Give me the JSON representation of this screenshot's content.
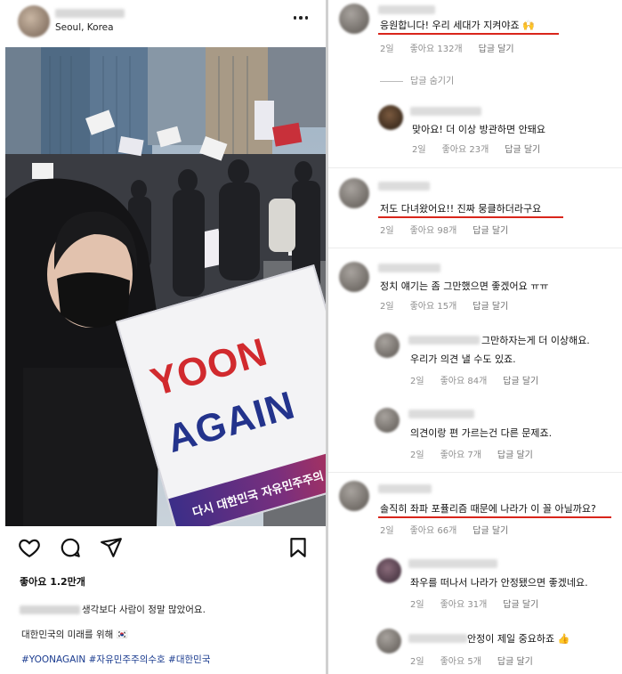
{
  "post": {
    "location": "Seoul, Korea",
    "likes": "좋아요 1.2만개",
    "caption_line1": "생각보다 사람이 정말 많았어요.",
    "caption_line2": "대한민국의 미래를 위해 🇰🇷",
    "hashtags": "#YOONAGAIN #자유민주주의수호 #대한민국",
    "sign": {
      "line1": "YOON",
      "line2": "AGAIN",
      "band": "다시 대한민국 자유민주주의 수호"
    },
    "icons": [
      "heart-icon",
      "comment-icon",
      "share-icon",
      "bookmark-icon",
      "more-icon"
    ]
  },
  "comments": [
    {
      "text": "응원합니다! 우리 세대가 지켜야죠 🙌",
      "age": "2일",
      "likes": "좋아요 132개",
      "reply_label": "답글 달기",
      "underlined": true
    },
    {
      "hide_replies": "답글 숨기기"
    },
    {
      "text": "맞아요! 더 이상 방관하면 안돼요",
      "age": "2일",
      "likes": "좋아요 23개",
      "reply_label": "답글 달기",
      "reply": true
    },
    {
      "text": "저도 다녀왔어요!! 진짜 뭉클하더라구요",
      "age": "2일",
      "likes": "좋아요 98개",
      "reply_label": "답글 달기",
      "underlined": true
    },
    {
      "text": "정치 얘기는 좀 그만했으면 좋겠어요 ㅠㅠ",
      "age": "2일",
      "likes": "좋아요 15개",
      "reply_label": "답글 달기"
    },
    {
      "text_line1": "그만하자는게 더 이상해요.",
      "text_line2": "우리가 의견 낼 수도 있죠.",
      "age": "2일",
      "likes": "좋아요 84개",
      "reply_label": "답글 달기",
      "reply": true
    },
    {
      "text": "의견이랑 편 가르는건 다른 문제죠.",
      "age": "2일",
      "likes": "좋아요 7개",
      "reply_label": "답글 달기",
      "reply": true
    },
    {
      "text": "솔직히 좌파 포퓰리즘 때문에 나라가 이 꼴 아닐까요?",
      "age": "2일",
      "likes": "좋아요 66개",
      "reply_label": "답글 달기",
      "underlined": true
    },
    {
      "text": "좌우를 떠나서 나라가 안정됐으면 좋겠네요.",
      "age": "2일",
      "likes": "좋아요 31개",
      "reply_label": "답글 달기",
      "reply": true
    },
    {
      "text": "안정이 제일 중요하죠 👍",
      "age": "2일",
      "likes": "좋아요 5개",
      "reply_label": "답글 달기",
      "reply": true
    }
  ],
  "colors": {
    "underline": "#d9251b",
    "hashtag": "#1a3b8f",
    "meta": "#8e8e8e"
  }
}
